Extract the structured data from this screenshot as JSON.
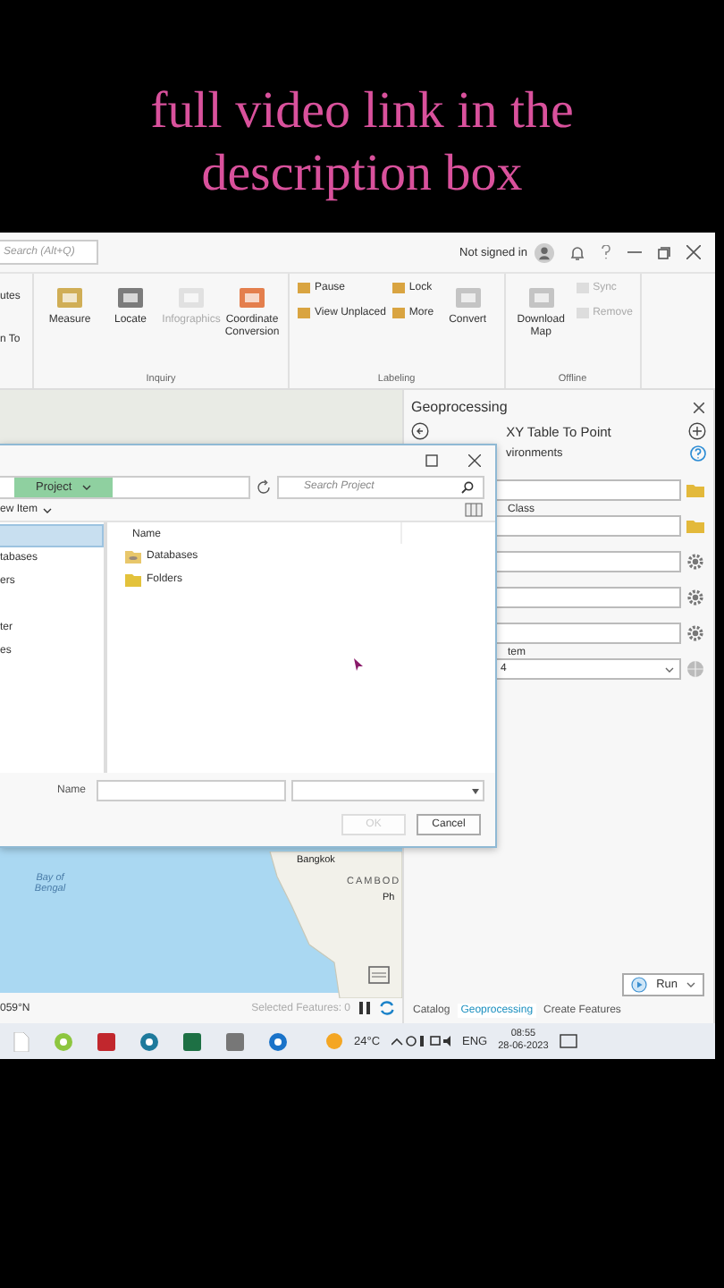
{
  "caption": "full video link in the description box",
  "title_bar": {
    "search_placeholder": "Search (Alt+Q)",
    "account": "Not signed in"
  },
  "ribbon": {
    "partial_items": [
      "utes",
      "n To"
    ],
    "groups": [
      {
        "label": "Inquiry",
        "buttons": [
          {
            "label": "Measure",
            "kind": "large",
            "disabled": false
          },
          {
            "label": "Locate",
            "kind": "large",
            "disabled": false
          },
          {
            "label": "Infographics",
            "kind": "large",
            "disabled": true
          },
          {
            "label": "Coordinate Conversion",
            "kind": "large",
            "disabled": false
          }
        ]
      },
      {
        "label": "Labeling",
        "buttons": [
          {
            "label": "Pause",
            "kind": "small",
            "disabled": false
          },
          {
            "label": "Lock",
            "kind": "small",
            "disabled": false
          },
          {
            "label": "View Unplaced",
            "kind": "small",
            "disabled": false
          },
          {
            "label": "More",
            "kind": "small",
            "disabled": false
          },
          {
            "label": "Convert",
            "kind": "large",
            "disabled": false
          }
        ]
      },
      {
        "label": "Offline",
        "buttons": [
          {
            "label": "Download Map",
            "kind": "large",
            "disabled": false
          },
          {
            "label": "Sync",
            "kind": "small",
            "disabled": true
          },
          {
            "label": "Remove",
            "kind": "small",
            "disabled": true
          }
        ]
      }
    ]
  },
  "map": {
    "labels": [
      {
        "text": "Bay of Bengal",
        "kind": "sea"
      },
      {
        "text": "Bangkok",
        "kind": "city"
      },
      {
        "text": "CAMBOD",
        "kind": "country"
      },
      {
        "text": "Ph",
        "kind": "city"
      }
    ]
  },
  "status_bar": {
    "coordinates": "059°N",
    "selected_features": "Selected Features: 0"
  },
  "dialog": {
    "breadcrumb": "Project",
    "search_placeholder": "Search Project",
    "new_item": "ew Item",
    "nav": [
      {
        "kind": "item",
        "selected": true
      },
      {
        "kind": "item",
        "label": "tabases",
        "selected": false
      },
      {
        "kind": "item",
        "label": "ers",
        "selected": false
      },
      {
        "kind": "spacer"
      },
      {
        "kind": "item",
        "label": "ter",
        "selected": false
      },
      {
        "kind": "item",
        "label": "es",
        "selected": false
      }
    ],
    "column": "Name",
    "items": [
      {
        "label": "Databases",
        "kind": "database"
      },
      {
        "label": "Folders",
        "kind": "folder"
      }
    ],
    "name_label": "Name",
    "ok": {
      "label": "OK",
      "disabled": true
    },
    "cancel": "Cancel"
  },
  "geoprocessing": {
    "title": "Geoprocessing",
    "tool": "XY Table To Point",
    "tab": "vironments",
    "params": [
      {
        "kind": "folder"
      },
      {
        "label": "Class",
        "kind": "folder"
      },
      {
        "kind": "gear"
      },
      {
        "kind": "gear"
      },
      {
        "kind": "gear"
      },
      {
        "label": "tem",
        "value": "4",
        "kind": "dropdown"
      }
    ],
    "run": "Run",
    "tabs": [
      {
        "label": "Catalog",
        "selected": false
      },
      {
        "label": "Geoprocessing",
        "selected": true
      },
      {
        "label": "Create Features",
        "selected": false
      }
    ]
  },
  "taskbar": {
    "temperature": "24°C",
    "language": "ENG",
    "time": "08:55",
    "date": "28-06-2023"
  }
}
